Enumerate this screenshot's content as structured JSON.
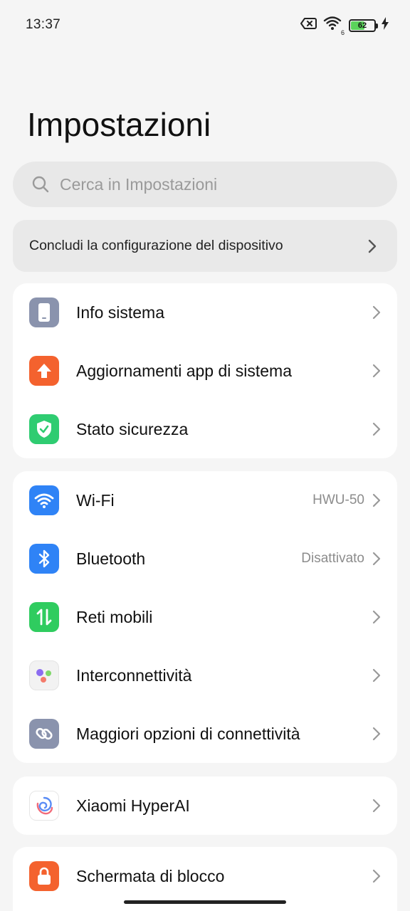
{
  "status_bar": {
    "time": "13:37",
    "battery_level": "62",
    "wifi_badge": "6",
    "icons": [
      "sim-error-icon",
      "wifi-icon",
      "battery-icon",
      "charging-icon"
    ]
  },
  "header": {
    "title": "Impostazioni"
  },
  "search": {
    "placeholder": "Cerca in Impostazioni"
  },
  "setup_card": {
    "label": "Concludi la configurazione del dispositivo"
  },
  "groups": [
    {
      "items": [
        {
          "label": "Info sistema",
          "icon": "phone-icon",
          "color": "#8a93ad"
        },
        {
          "label": "Aggiornamenti app di sistema",
          "icon": "arrow-up-icon",
          "color": "#f4622e"
        },
        {
          "label": "Stato sicurezza",
          "icon": "shield-check-icon",
          "color": "#2fcc71"
        }
      ]
    },
    {
      "items": [
        {
          "label": "Wi-Fi",
          "value": "HWU-50",
          "icon": "wifi-icon",
          "color": "#2f83f6"
        },
        {
          "label": "Bluetooth",
          "value": "Disattivato",
          "icon": "bluetooth-icon",
          "color": "#2f83f6"
        },
        {
          "label": "Reti mobili",
          "icon": "mobile-data-icon",
          "color": "#2fcc5f"
        },
        {
          "label": "Interconnettività",
          "icon": "interconnect-icon",
          "color": "#f2f2f2"
        },
        {
          "label": "Maggiori opzioni di connettività",
          "icon": "link-icon",
          "color": "#8a93ad"
        }
      ]
    },
    {
      "items": [
        {
          "label": "Xiaomi HyperAI",
          "icon": "hyperai-icon",
          "color": "#ffffff"
        }
      ]
    },
    {
      "items": [
        {
          "label": "Schermata di blocco",
          "icon": "lock-icon",
          "color": "#f4622e"
        }
      ]
    }
  ]
}
